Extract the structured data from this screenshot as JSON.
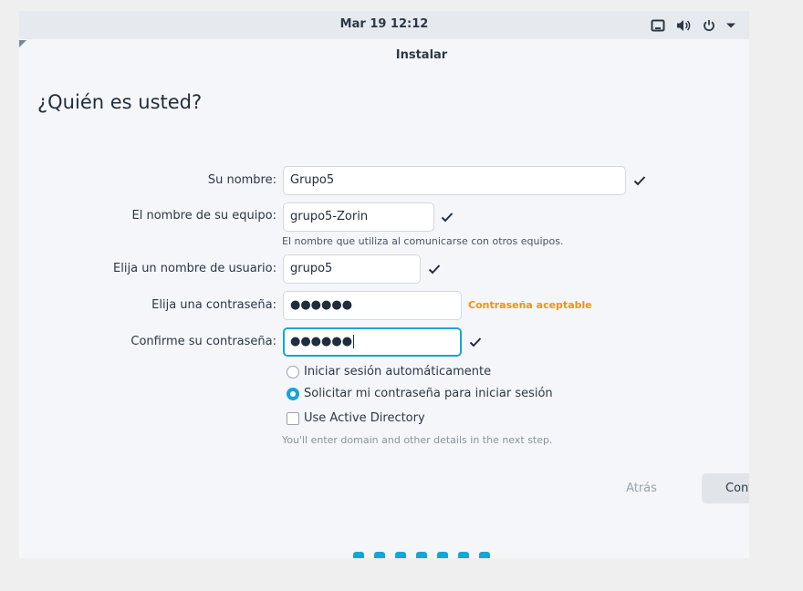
{
  "topbar": {
    "clock": "Mar 19  12:12",
    "icons": [
      "screen-icon",
      "volume-icon",
      "power-icon",
      "menu-arrow-icon"
    ]
  },
  "window": {
    "title": "Instalar",
    "heading": "¿Quién es usted?"
  },
  "form": {
    "name_label": "Su nombre:",
    "name_value": "Grupo5",
    "computer_label": "El nombre de su equipo:",
    "computer_value": "grupo5-Zorin",
    "computer_hint": "El nombre que utiliza al comunicarse con otros equipos.",
    "username_label": "Elija un nombre de usuario:",
    "username_value": "grupo5",
    "password_label": "Elija una contraseña:",
    "password_value": "●●●●●●",
    "password_strength": "Contraseña aceptable",
    "confirm_label": "Confirme su contraseña:",
    "confirm_value": "●●●●●●",
    "option_auto_login": "Iniciar sesión automáticamente",
    "option_require_password": "Solicitar mi contraseña para iniciar sesión",
    "selected_option": "require_password",
    "active_directory_label": "Use Active Directory",
    "active_directory_checked": false,
    "active_directory_hint": "You'll enter domain and other details in the next step."
  },
  "buttons": {
    "back": "Atrás",
    "next": "Continuar"
  },
  "progress": {
    "steps_shown": 7,
    "accent_color": "#15a6d8"
  },
  "colors": {
    "accent": "#15a6d8",
    "warning": "#f0930c"
  }
}
